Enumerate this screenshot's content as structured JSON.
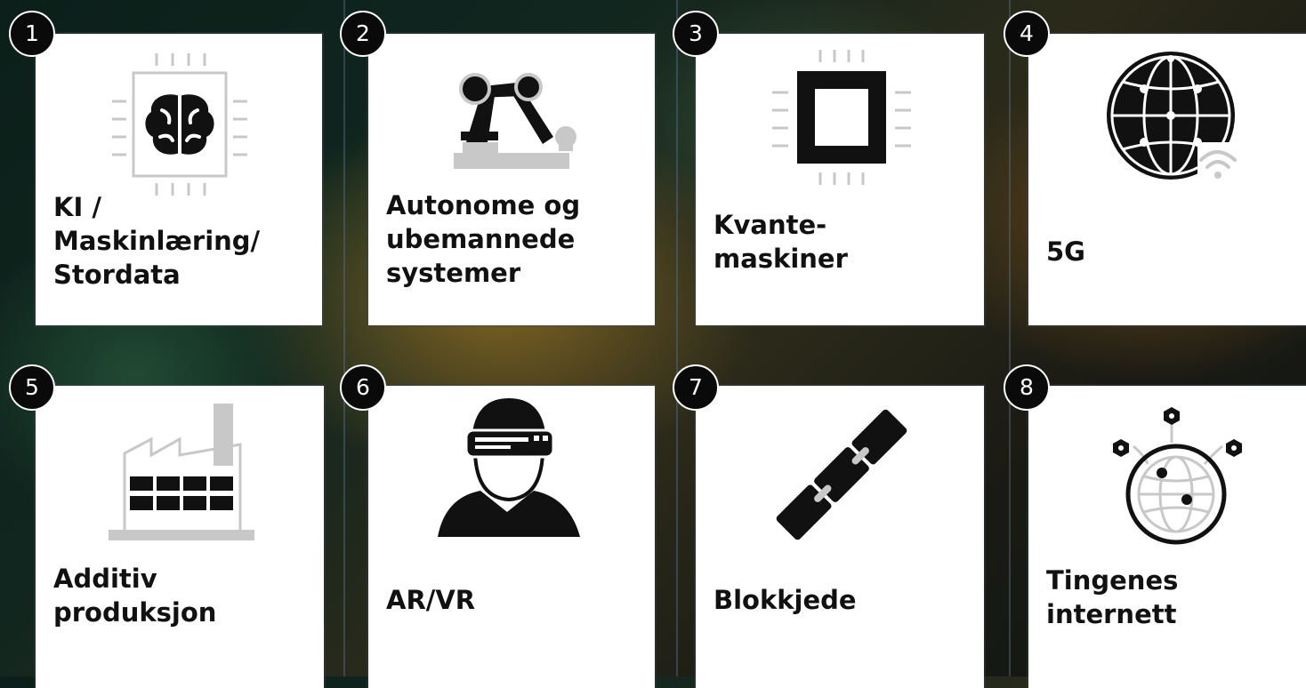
{
  "cards": [
    {
      "number": "1",
      "label": "KI /\nMaskinlæring/\nStordata",
      "icon": "brain-chip-icon"
    },
    {
      "number": "2",
      "label": "Autonome og\nubemannede\nsystemer",
      "icon": "robot-arm-icon"
    },
    {
      "number": "3",
      "label": "Kvante-\nmaskiner",
      "icon": "processor-chip-icon"
    },
    {
      "number": "4",
      "label": "5G",
      "icon": "globe-wifi-icon"
    },
    {
      "number": "5",
      "label": "Additiv\nproduksjon",
      "icon": "factory-icon"
    },
    {
      "number": "6",
      "label": "AR/VR",
      "icon": "vr-headset-person-icon"
    },
    {
      "number": "7",
      "label": "Blokkjede",
      "icon": "chain-link-icon"
    },
    {
      "number": "8",
      "label": "Tingenes\ninternett",
      "icon": "iot-globe-icon"
    }
  ],
  "colors": {
    "icon_dark": "#111111",
    "icon_light": "#c8c8c8",
    "card": "#ffffff",
    "badge": "#0a0a0a"
  }
}
